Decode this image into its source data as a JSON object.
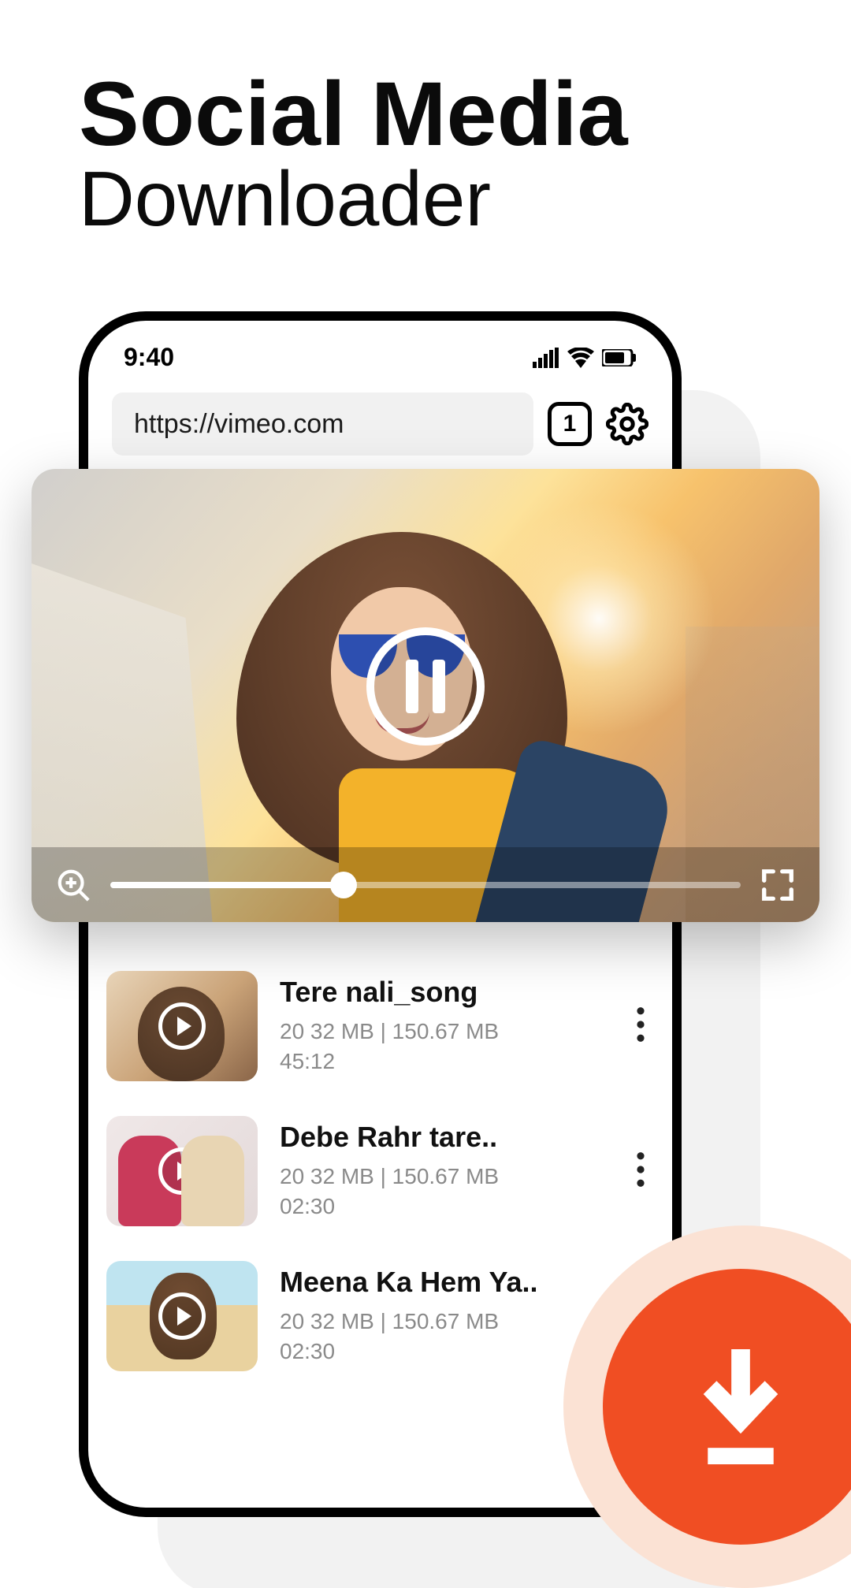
{
  "headline": {
    "line1": "Social Media",
    "line2": "Downloader"
  },
  "status": {
    "time": "9:40"
  },
  "urlbar": {
    "value": "https://vimeo.com",
    "tab_count": "1"
  },
  "player": {
    "progress_pct": 37
  },
  "list": [
    {
      "title": "Tere nali_song",
      "size_line": "20 32 MB | 150.67 MB",
      "duration": "45:12",
      "has_menu": true,
      "thumb_class": "thumb1"
    },
    {
      "title": "Debe Rahr tare..",
      "size_line": "20 32 MB | 150.67 MB",
      "duration": "02:30",
      "has_menu": true,
      "thumb_class": "thumb2"
    },
    {
      "title": "Meena Ka Hem Ya..",
      "size_line": "20 32 MB | 150.67 MB",
      "duration": "02:30",
      "has_menu": false,
      "thumb_class": "thumb3"
    }
  ]
}
